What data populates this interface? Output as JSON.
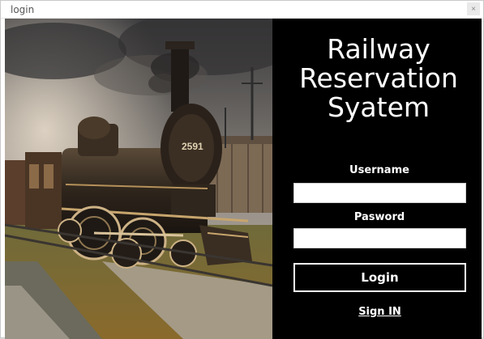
{
  "window": {
    "title": "login",
    "close_glyph": "×"
  },
  "photo": {
    "description_icon": "steam-locomotive-image",
    "engine_number": "2591"
  },
  "panel": {
    "app_title_line1": "Railway",
    "app_title_line2": "Reservation",
    "app_title_line3": "Syatem",
    "username_label": "Username",
    "username_value": "",
    "password_label": "Pasword",
    "password_value": "",
    "login_button_label": "Login",
    "signin_link_label": "Sign IN"
  },
  "colors": {
    "panel_background": "#000000",
    "text": "#ffffff",
    "input_background": "#ffffff"
  }
}
